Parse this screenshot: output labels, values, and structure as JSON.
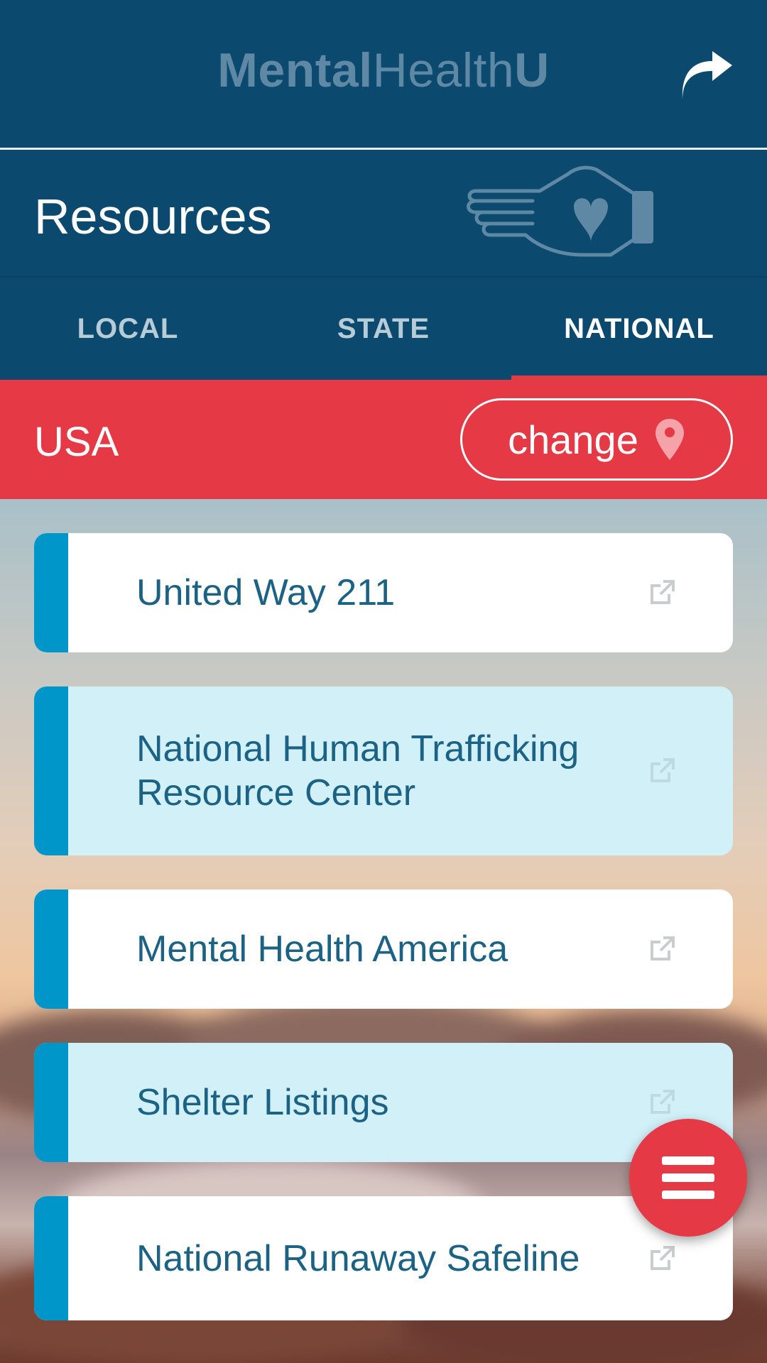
{
  "header": {
    "logo_bold": "Mental",
    "logo_light": "Health",
    "logo_end": "U",
    "share_icon": "share-arrow-icon"
  },
  "section": {
    "title": "Resources",
    "icon": "hand-heart-icon"
  },
  "tabs": [
    {
      "label": "LOCAL",
      "active": false
    },
    {
      "label": "STATE",
      "active": false
    },
    {
      "label": "NATIONAL",
      "active": true
    }
  ],
  "location": {
    "name": "USA",
    "change_label": "change",
    "pin_icon": "map-pin-icon"
  },
  "resources": [
    {
      "name": "United Way 211",
      "icon": "external-link-icon"
    },
    {
      "name": "National Human Trafficking Resource Center",
      "icon": "external-link-icon"
    },
    {
      "name": "Mental Health America",
      "icon": "external-link-icon"
    },
    {
      "name": "Shelter Listings",
      "icon": "external-link-icon"
    },
    {
      "name": "National Runaway Safeline",
      "icon": "external-link-icon"
    }
  ],
  "fab": {
    "icon": "menu-icon"
  },
  "colors": {
    "navy": "#0b4a6e",
    "accent_red": "#e63946",
    "stripe_blue": "#0096c9",
    "card_alt": "#d1f0f8",
    "text_blue": "#1b6284"
  }
}
